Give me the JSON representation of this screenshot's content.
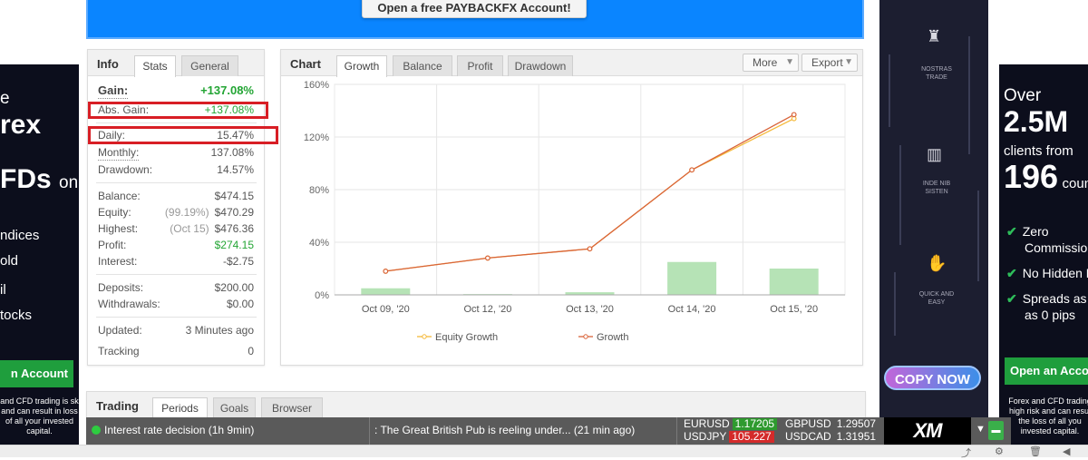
{
  "banner": {
    "button_label": "Open a free PAYBACKFX Account!"
  },
  "ad_left": {
    "line1": "e",
    "line2": "rex",
    "line3": "FDs",
    "line3_suffix": "on",
    "items": [
      "ndices",
      "old",
      "il",
      "tocks"
    ],
    "cta": "n Account",
    "disclaimer": "and CFD trading is sk and can result in loss of all your invested capital."
  },
  "ad_right": {
    "over": "Over",
    "big1": "2.5M",
    "clients_from": "clients from",
    "big2": "196",
    "countries": "count",
    "items": [
      {
        "line1": "Zero",
        "line2": "Commissio"
      },
      {
        "line1": "No Hidden F",
        "line2": ""
      },
      {
        "line1": "Spreads as",
        "line2": "as 0 pips"
      }
    ],
    "cta": "Open an Acco",
    "disclaimer": "Forex and CFD trading high risk and can resul the loss of all you invested capital."
  },
  "ad_right_dark": {
    "labels": [
      "NOSTRAS TRADE",
      "INDE NIB SISTEN",
      "QUICK AND EASY"
    ],
    "copy_now": "COPY NOW"
  },
  "info_panel": {
    "title": "Info",
    "tabs": [
      "Stats",
      "General"
    ],
    "gain_label": "Gain:",
    "gain_value": "+137.08%",
    "abs_gain_label": "Abs. Gain:",
    "abs_gain_value": "+137.08%",
    "daily_label": "Daily:",
    "daily_value": "15.47%",
    "monthly_label": "Monthly:",
    "monthly_value": "137.08%",
    "drawdown_label": "Drawdown:",
    "drawdown_value": "14.57%",
    "balance_label": "Balance:",
    "balance_value": "$474.15",
    "equity_label": "Equity:",
    "equity_pct": "(99.19%)",
    "equity_value": "$470.29",
    "highest_label": "Highest:",
    "highest_date": "(Oct 15)",
    "highest_value": "$476.36",
    "profit_label": "Profit:",
    "profit_value": "$274.15",
    "interest_label": "Interest:",
    "interest_value": "-$2.75",
    "deposits_label": "Deposits:",
    "deposits_value": "$200.00",
    "withdrawals_label": "Withdrawals:",
    "withdrawals_value": "$0.00",
    "updated_label": "Updated:",
    "updated_value": "3 Minutes ago",
    "tracking_label": "Tracking",
    "tracking_value": "0"
  },
  "chart_panel": {
    "title": "Chart",
    "tabs": [
      "Growth",
      "Balance",
      "Profit",
      "Drawdown"
    ],
    "more_label": "More",
    "export_label": "Export"
  },
  "chart_data": {
    "type": "line",
    "categories": [
      "Oct 09, '20",
      "Oct 12, '20",
      "Oct 13, '20",
      "Oct 14, '20",
      "Oct 15, '20"
    ],
    "yticks": [
      "0%",
      "40%",
      "80%",
      "120%",
      "160%"
    ],
    "ylim": [
      0,
      160
    ],
    "grid": true,
    "legend_position": "bottom",
    "series": [
      {
        "name": "Equity Growth",
        "type": "line",
        "color": "#f5b93a",
        "values": [
          18,
          28,
          35,
          95,
          134
        ]
      },
      {
        "name": "Growth",
        "type": "line",
        "color": "#d9643a",
        "values": [
          18,
          28,
          35,
          95,
          137
        ]
      },
      {
        "type": "bar",
        "color": "#b6e3b6",
        "values": [
          5,
          0.6,
          2,
          25,
          20
        ]
      }
    ]
  },
  "trading_panel": {
    "title": "Trading",
    "tabs": [
      "Periods",
      "Goals",
      "Browser"
    ]
  },
  "ticker": {
    "news1": "Interest rate decision (1h 9min)",
    "news2": ": The Great British Pub is reeling under...  (21 min ago)",
    "pairs": [
      {
        "name": "EURUSD",
        "price": "1.17205",
        "dir": "up"
      },
      {
        "name": "GBPUSD",
        "price": "1.29507",
        "dir": "none"
      },
      {
        "name": "USDJPY",
        "price": "105.227",
        "dir": "down"
      },
      {
        "name": "USDCAD",
        "price": "1.31951",
        "dir": "none"
      }
    ],
    "brand": "XM"
  }
}
